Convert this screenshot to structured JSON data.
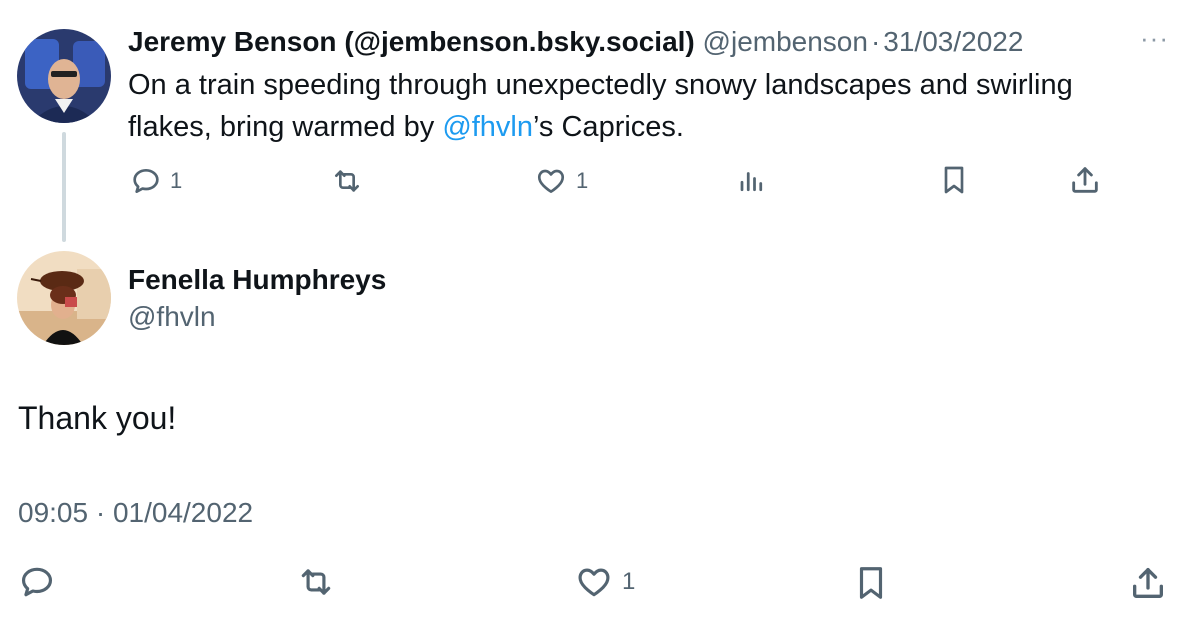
{
  "parent_tweet": {
    "display_name": "Jeremy Benson (@jembenson.bsky.social)",
    "handle": "@jembenson",
    "separator": "·",
    "date": "31/03/2022",
    "more_label": "···",
    "text_before": "On a train speeding through unexpectedly snowy landscapes and swirling flakes, bring warmed by ",
    "mention": "@fhvln",
    "text_after": "’s Caprices.",
    "actions": {
      "reply_count": "1",
      "retweet_count": "",
      "like_count": "1"
    }
  },
  "main_tweet": {
    "display_name": "Fenella Humphreys",
    "handle": "@fhvln",
    "text": "Thank you!",
    "timestamp": "09:05 · 01/04/2022",
    "actions": {
      "like_count": "1"
    }
  },
  "colors": {
    "text": "#0f1419",
    "muted": "#536471",
    "link": "#1d9bf0",
    "thread_line": "#cfd9de"
  },
  "icons": [
    "reply-icon",
    "retweet-icon",
    "like-icon",
    "views-icon",
    "bookmark-icon",
    "share-icon",
    "more-icon"
  ]
}
